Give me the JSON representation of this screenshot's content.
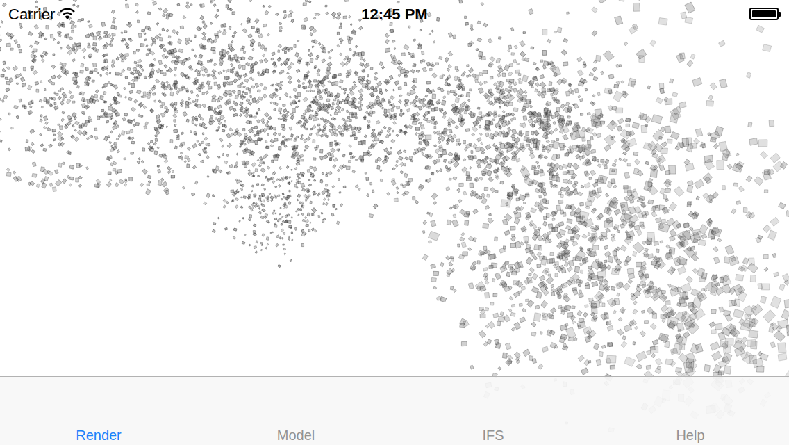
{
  "status_bar": {
    "carrier": "Carrier",
    "time": "12:45 PM",
    "battery_level": 1
  },
  "tabs": [
    {
      "label": "Render",
      "selected": true
    },
    {
      "label": "Model",
      "selected": false
    },
    {
      "label": "IFS",
      "selected": false
    },
    {
      "label": "Help",
      "selected": false
    }
  ]
}
